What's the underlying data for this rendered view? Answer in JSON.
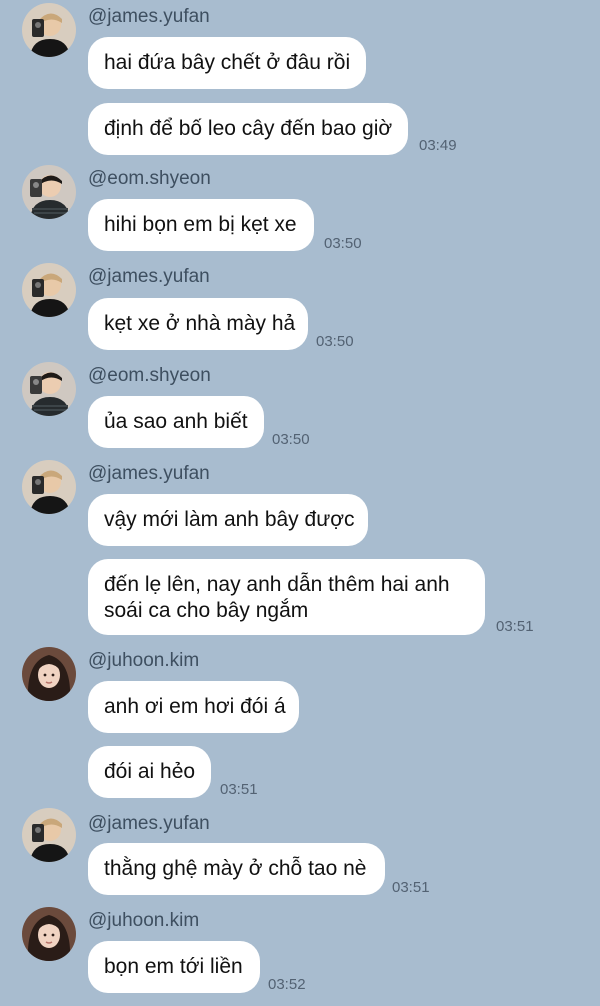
{
  "colors": {
    "background": "#a8bccf",
    "bubble": "#ffffff",
    "sender_text": "#3e4f60",
    "time_text": "#536273"
  },
  "messages": [
    {
      "sender": "@james.yufan",
      "avatar": "avatar-james-icon",
      "bubbles": [
        "hai đứa bây chết ở đâu rồi",
        "định để bố leo cây đến bao giờ"
      ],
      "time": "03:49"
    },
    {
      "sender": "@eom.shyeon",
      "avatar": "avatar-eom-icon",
      "bubbles": [
        "hihi bọn em bị kẹt xe"
      ],
      "time": "03:50"
    },
    {
      "sender": "@james.yufan",
      "avatar": "avatar-james-icon",
      "bubbles": [
        "kẹt xe ở nhà mày hả"
      ],
      "time": "03:50"
    },
    {
      "sender": "@eom.shyeon",
      "avatar": "avatar-eom-icon",
      "bubbles": [
        "ủa sao anh biết"
      ],
      "time": "03:50"
    },
    {
      "sender": "@james.yufan",
      "avatar": "avatar-james-icon",
      "bubbles": [
        "vậy mới làm anh bây được",
        "đến lẹ lên, nay anh dẫn thêm hai anh soái ca cho bây ngắm"
      ],
      "time": "03:51"
    },
    {
      "sender": "@juhoon.kim",
      "avatar": "avatar-juhoon-icon",
      "bubbles": [
        "anh ơi em hơi đói á",
        "đói ai hẻo"
      ],
      "time": "03:51"
    },
    {
      "sender": "@james.yufan",
      "avatar": "avatar-james-icon",
      "bubbles": [
        "thằng ghệ mày ở chỗ tao nè"
      ],
      "time": "03:51"
    },
    {
      "sender": "@juhoon.kim",
      "avatar": "avatar-juhoon-icon",
      "bubbles": [
        "bọn em tới liền"
      ],
      "time": "03:52"
    }
  ]
}
